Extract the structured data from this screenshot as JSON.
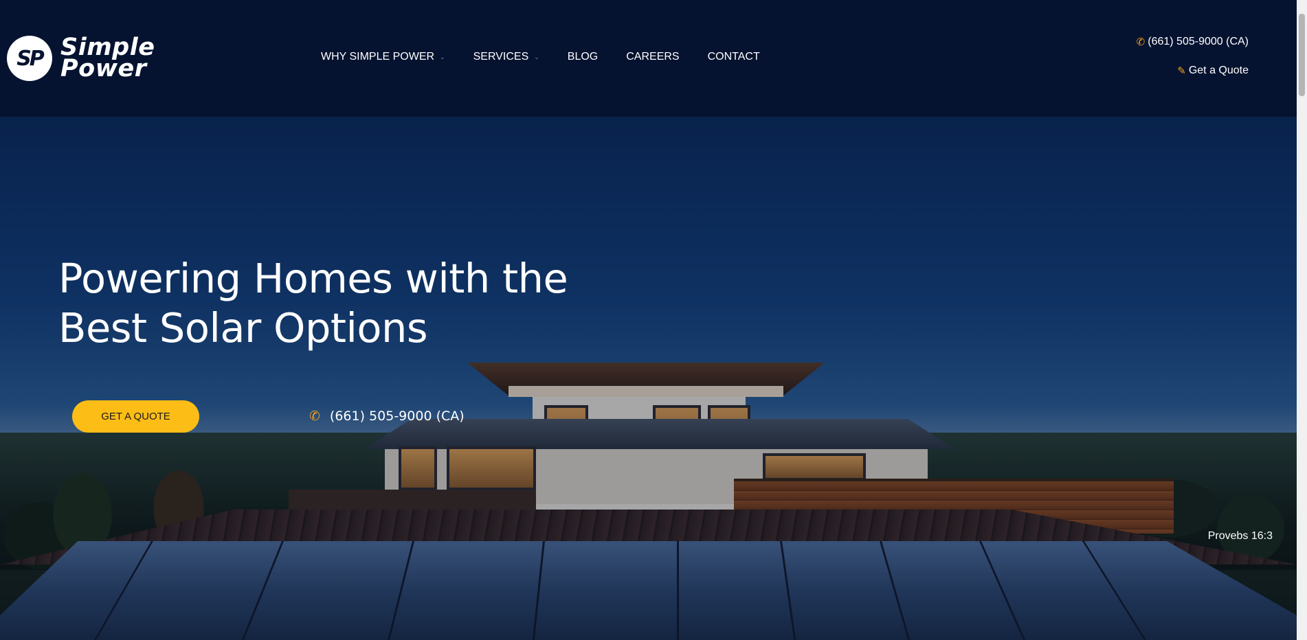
{
  "header": {
    "logo": {
      "monogram": "SP",
      "line1": "Simple",
      "line2": "Power"
    },
    "nav": [
      {
        "label": "WHY SIMPLE POWER",
        "has_dropdown": true
      },
      {
        "label": "SERVICES",
        "has_dropdown": true
      },
      {
        "label": "BLOG",
        "has_dropdown": false
      },
      {
        "label": "CAREERS",
        "has_dropdown": false
      },
      {
        "label": "CONTACT",
        "has_dropdown": false
      }
    ],
    "phone": "(661) 505-9000 (CA)",
    "phone_icon": "phone-icon",
    "quote_label": "Get a Quote",
    "quote_icon": "edit-icon"
  },
  "hero": {
    "title_line1": "Powering Homes with the",
    "title_line2": "Best Solar Options",
    "cta_label": "GET A QUOTE",
    "phone": "(661) 505-9000 (CA)",
    "verse": "Provebs 16:3"
  },
  "colors": {
    "header_bg": "#061330",
    "accent": "#fdbd17",
    "icon_orange": "#f5a11c"
  }
}
